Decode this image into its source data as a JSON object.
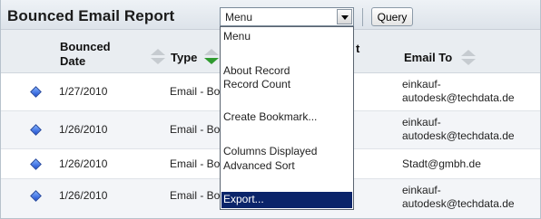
{
  "report": {
    "title": "Bounced Email Report",
    "menu_select_value": "Menu",
    "query_label": "Query"
  },
  "table": {
    "columns": {
      "bounced_date": "Bounced Date",
      "type": "Type",
      "email_to": "Email To",
      "hidden_suffix": "t"
    },
    "rows": [
      {
        "date": "1/27/2010",
        "type": "Email - Bo",
        "email_to": "einkauf-autodesk@techdata.de"
      },
      {
        "date": "1/26/2010",
        "type": "Email - Bo",
        "email_to": "einkauf-autodesk@techdata.de"
      },
      {
        "date": "1/26/2010",
        "type": "Email - Bo",
        "email_to": "Stadt@gmbh.de"
      },
      {
        "date": "1/26/2010",
        "type": "Email - Bo",
        "email_to": "einkauf-autodesk@techdata.de"
      }
    ]
  },
  "dropdown": {
    "items": [
      {
        "label": "Menu"
      },
      {
        "label": "About Record"
      },
      {
        "label": "Record Count"
      },
      {
        "label": "Create Bookmark..."
      },
      {
        "label": "Columns Displayed"
      },
      {
        "label": "Advanced Sort"
      },
      {
        "label": "Export..."
      }
    ],
    "selected_index": 6
  },
  "colors": {
    "selection": "#0a246a",
    "sort_active": "#2f9a2f",
    "bullet": "#1f4fd1"
  }
}
